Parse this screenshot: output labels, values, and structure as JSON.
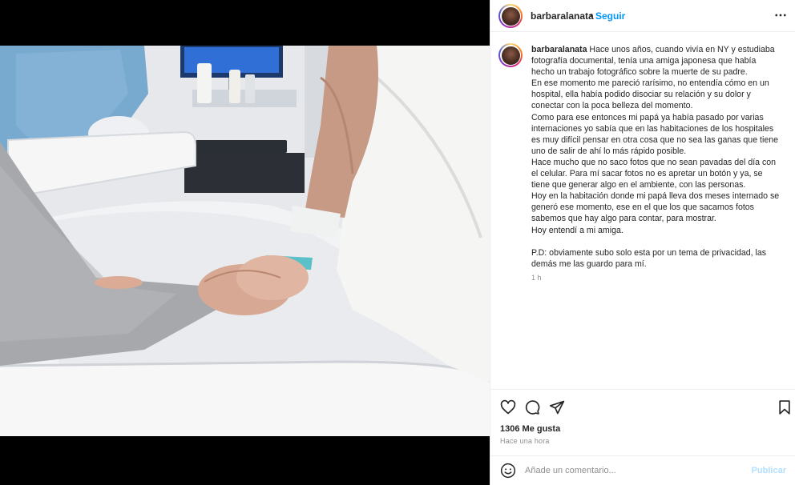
{
  "post": {
    "username": "barbaralanata",
    "separator": "•",
    "follow_label": "Seguir",
    "more_label": "•••"
  },
  "caption": {
    "username": "barbaralanata",
    "text": " Hace unos años, cuando vivía en NY y estudiaba fotografía documental, tenía una amiga japonesa que había hecho un trabajo fotográfico sobre la muerte de su padre.\nEn ese momento me pareció rarísimo, no entendía cómo en un hospital, ella había podido disociar su relación y su dolor y conectar con la poca belleza del momento.\nComo para ese entonces mi papá ya había pasado por varias internaciones yo sabía que en las habitaciones de los hospitales es muy difícil pensar en otra cosa que no sea las ganas que tiene uno de salir de ahí lo más rápido posible.\nHace mucho que no saco fotos que no sean pavadas del día con el celular. Para mí sacar fotos no es apretar un botón y ya, se tiene que generar algo en el ambiente, con las personas.\nHoy en la habitación donde mi papá lleva dos meses internado se generó ese momento, ese en el que los que sacamos fotos sabemos que hay algo para contar, para mostrar.\nHoy entendí a mi amiga.\n\nP.D: obviamente subo solo esta por un tema de privacidad, las demás me las guardo para mí.",
    "time": "1 h"
  },
  "actions": {
    "likes": "1306 Me gusta",
    "ago": "Hace una hora"
  },
  "comment": {
    "placeholder": "Añade un comentario...",
    "publish_label": "Publicar"
  },
  "colors": {
    "link_blue": "#0095f6",
    "publish_disabled": "#b2dffc",
    "muted": "#8e8e8e"
  }
}
